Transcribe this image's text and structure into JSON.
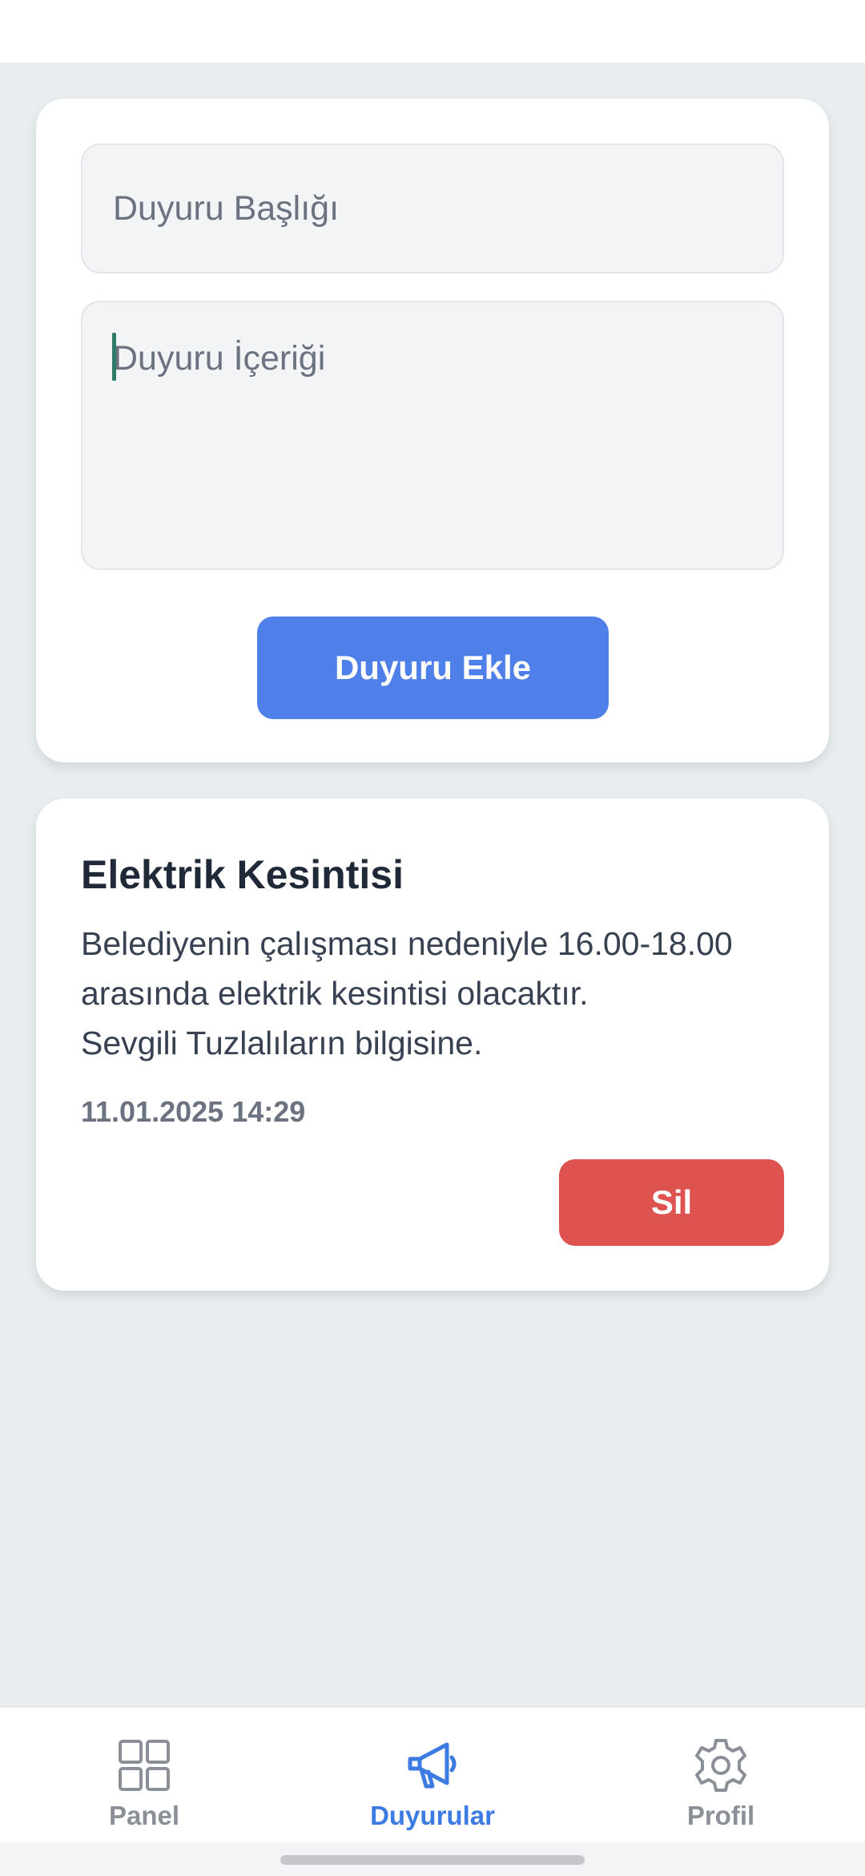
{
  "form": {
    "title_placeholder": "Duyuru Başlığı",
    "content_placeholder": "Duyuru İçeriği",
    "add_button_label": "Duyuru Ekle"
  },
  "announcements": [
    {
      "title": "Elektrik Kesintisi",
      "body": "Belediyenin çalışması nedeniyle 16.00-18.00\narasında elektrik kesintisi olacaktır.\nSevgili Tuzlalıların bilgisine.",
      "date": "11.01.2025 14:29",
      "delete_label": "Sil"
    }
  ],
  "nav": {
    "items": [
      {
        "label": "Panel",
        "icon": "grid-icon",
        "active": false
      },
      {
        "label": "Duyurular",
        "icon": "megaphone-icon",
        "active": true
      },
      {
        "label": "Profil",
        "icon": "gear-icon",
        "active": false
      }
    ]
  },
  "colors": {
    "primary": "#4f80ea",
    "danger": "#de524f",
    "nav_active": "#3b7be2",
    "nav_inactive": "#8a8f98",
    "background": "#e8eef0"
  }
}
